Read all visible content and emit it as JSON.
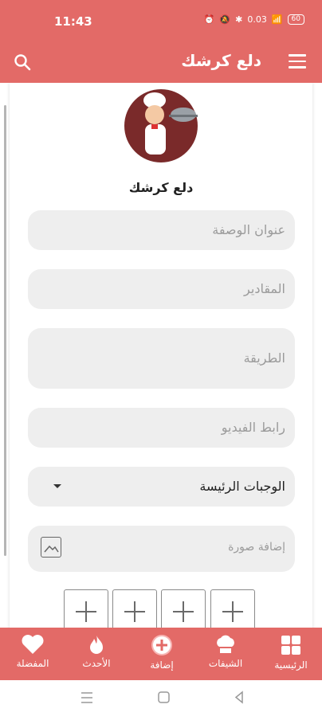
{
  "status": {
    "time": "11:43",
    "speed": "0.03",
    "battery": "60"
  },
  "appbar": {
    "title": "دلع كرشك"
  },
  "brand": {
    "name": "دلع كرشك"
  },
  "form": {
    "title_placeholder": "عنوان الوصفة",
    "ingredients_placeholder": "المقادير",
    "method_placeholder": "الطريقة",
    "video_placeholder": "رابط الفيديو",
    "category_value": "الوجبات الرئيسة",
    "image_label": "إضافة صورة"
  },
  "nav": {
    "favorites": "المفضلة",
    "latest": "الأحدث",
    "add": "إضافة",
    "chefs": "الشيفات",
    "home": "الرئيسية"
  },
  "colors": {
    "primary": "#e36a67",
    "field_bg": "#eeeeee"
  }
}
